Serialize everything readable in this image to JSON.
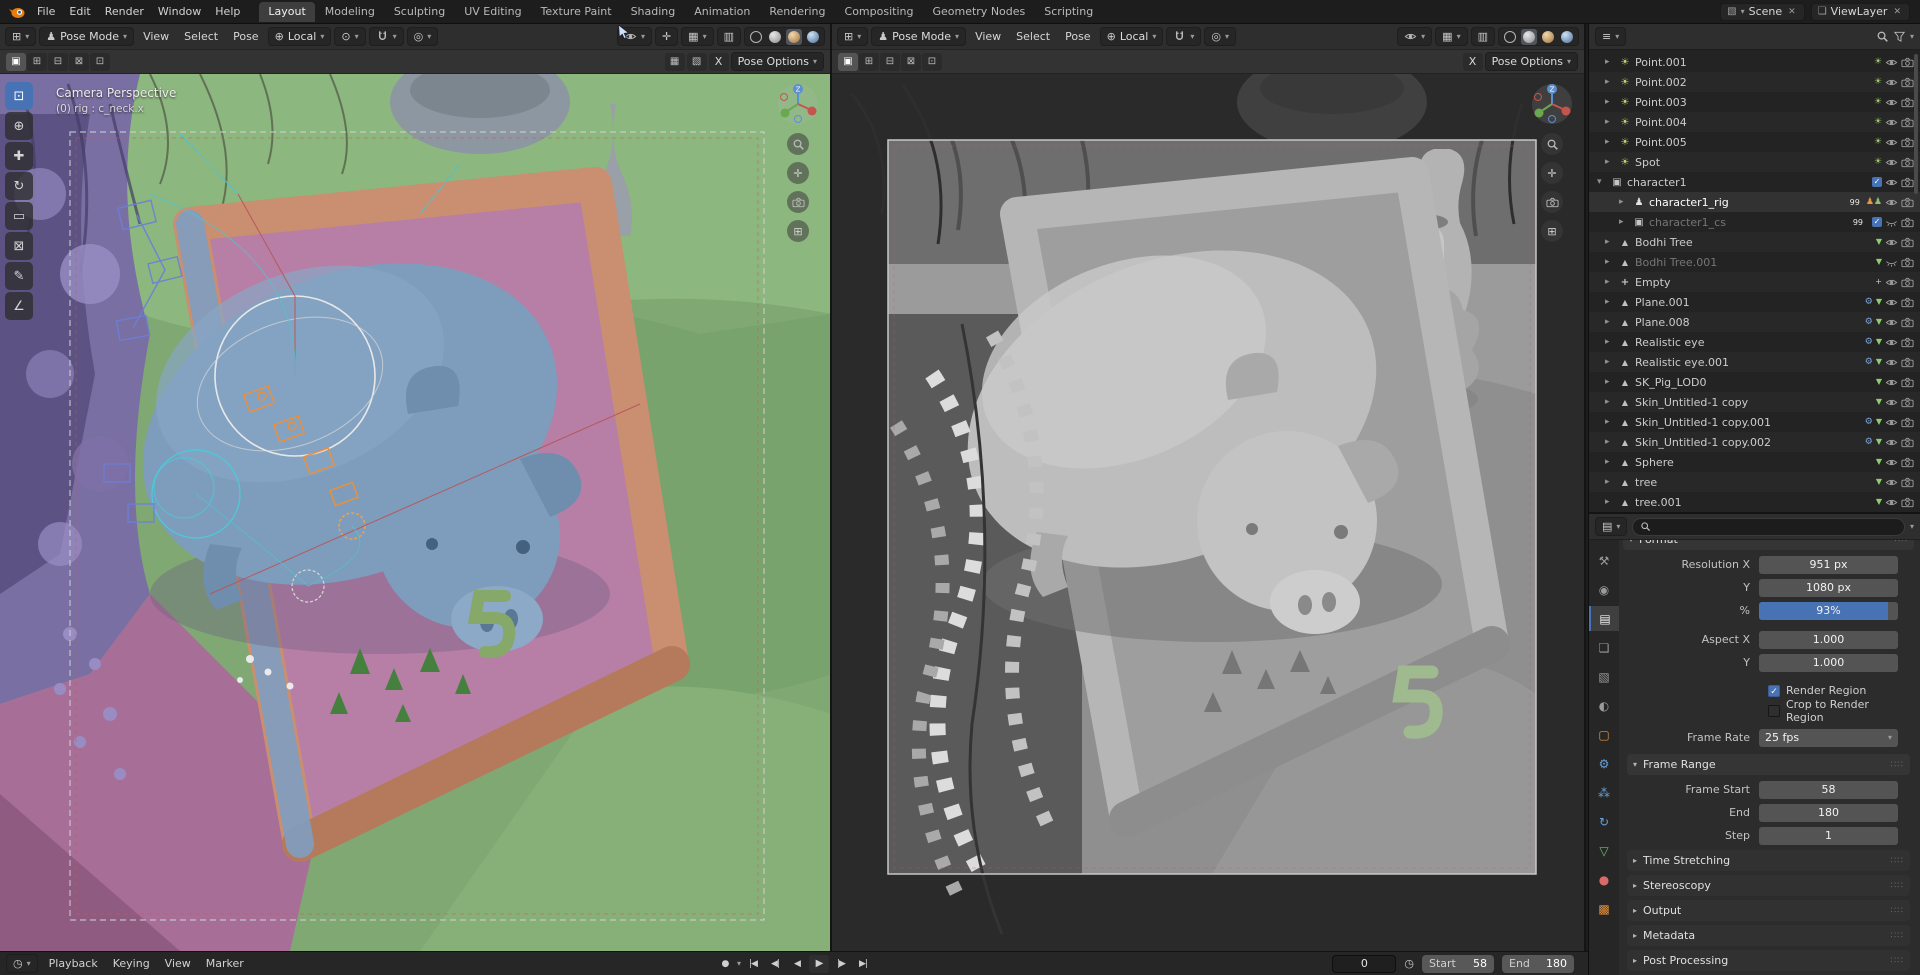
{
  "colors": {
    "accent": "#4772b3",
    "slider_fill": "#4772b3",
    "active_tab_bg": "#3e3e3e",
    "mesh_green": "#8ccf6e",
    "armature_orange": "#e8973c"
  },
  "glyphs": {
    "editor_3d": "⊞",
    "editor_outliner": "≡",
    "editor_props": "▤",
    "editor_timeline": "◷",
    "chevron": "▾",
    "mode": "♟",
    "orientation": "⊕",
    "pivot": "⊙",
    "proportional": "◎",
    "overlays": "▦",
    "xray": "▥",
    "gizmo": "✛",
    "grid": "⊞",
    "collapsed": "▸",
    "expanded": "▾",
    "grip": "∷∷"
  },
  "topbar": {
    "menus": [
      "File",
      "Edit",
      "Render",
      "Window",
      "Help"
    ],
    "workspaces": [
      {
        "label": "Layout",
        "active": "true"
      },
      {
        "label": "Modeling"
      },
      {
        "label": "Sculpting"
      },
      {
        "label": "UV Editing"
      },
      {
        "label": "Texture Paint"
      },
      {
        "label": "Shading"
      },
      {
        "label": "Animation"
      },
      {
        "label": "Rendering"
      },
      {
        "label": "Compositing"
      },
      {
        "label": "Geometry Nodes"
      },
      {
        "label": "Scripting"
      }
    ],
    "scene_name": "Scene",
    "view_layer_name": "ViewLayer"
  },
  "tool_settings": {
    "select_modes": [
      {
        "m": "set",
        "glyph": "▣",
        "active": "true"
      },
      {
        "m": "extend",
        "glyph": "⊞"
      },
      {
        "m": "subtract",
        "glyph": "⊟"
      },
      {
        "m": "invert",
        "glyph": "⊠"
      },
      {
        "m": "intersect",
        "glyph": "⊡"
      }
    ]
  },
  "viewports": {
    "left": {
      "mode": "Pose Mode",
      "menu_view": "View",
      "menu_select": "Select",
      "menu_pose": "Pose",
      "orientation": "Local",
      "mirror_x": "X",
      "tool_popover": "Pose Options",
      "shading_active": "material",
      "overlay_line1": "Camera Perspective",
      "overlay_line2": "(0) rig : c_neck.x",
      "tools": [
        {
          "tool": "select-box",
          "glyph": "⊡",
          "active": "true"
        },
        {
          "tool": "cursor",
          "glyph": "⊕"
        },
        {
          "tool": "move",
          "glyph": "✚"
        },
        {
          "tool": "rotate",
          "glyph": "↻"
        },
        {
          "tool": "scale",
          "glyph": "▭"
        },
        {
          "tool": "transform",
          "glyph": "⊠"
        },
        {
          "tool": "annotate",
          "glyph": "✎"
        },
        {
          "tool": "measure",
          "glyph": "∠"
        }
      ]
    },
    "right": {
      "mode": "Pose Mode",
      "menu_view": "View",
      "menu_select": "Select",
      "menu_pose": "Pose",
      "orientation": "Local",
      "mirror_x": "X",
      "tool_popover": "Pose Options",
      "shading_active": "solid"
    }
  },
  "outliner": {
    "rows": [
      {
        "arrow": "▸",
        "name": "Point.001",
        "type": "light"
      },
      {
        "arrow": "▸",
        "name": "Point.002",
        "type": "light"
      },
      {
        "arrow": "▸",
        "name": "Point.003",
        "type": "light"
      },
      {
        "arrow": "▸",
        "name": "Point.004",
        "type": "light"
      },
      {
        "arrow": "▸",
        "name": "Point.005",
        "type": "light"
      },
      {
        "arrow": "▸",
        "name": "Spot",
        "type": "light"
      },
      {
        "arrow": "▾",
        "name": "character1",
        "type": "collection",
        "depth": "0"
      },
      {
        "arrow": "▸",
        "name": "character1_rig",
        "type": "armature",
        "depth": "2",
        "state": "active",
        "meta": "99"
      },
      {
        "arrow": "▸",
        "name": "character1_cs",
        "type": "collection",
        "depth": "2",
        "state": "muted",
        "meta": "99"
      },
      {
        "arrow": "▸",
        "name": "Bodhi Tree",
        "type": "mesh"
      },
      {
        "arrow": "▸",
        "name": "Bodhi Tree.001",
        "type": "mesh",
        "state": "muted"
      },
      {
        "arrow": "▸",
        "name": "Empty",
        "type": "empty"
      },
      {
        "arrow": "▸",
        "name": "Plane.001",
        "type": "mesh",
        "mod": "⚙"
      },
      {
        "arrow": "▸",
        "name": "Plane.008",
        "type": "mesh",
        "mod": "⚙"
      },
      {
        "arrow": "▸",
        "name": "Realistic eye",
        "type": "mesh",
        "mod": "⚙"
      },
      {
        "arrow": "▸",
        "name": "Realistic eye.001",
        "type": "mesh",
        "mod": "⚙"
      },
      {
        "arrow": "▸",
        "name": "SK_Pig_LOD0",
        "type": "mesh"
      },
      {
        "arrow": "▸",
        "name": "Skin_Untitled-1 copy",
        "type": "mesh"
      },
      {
        "arrow": "▸",
        "name": "Skin_Untitled-1 copy.001",
        "type": "mesh",
        "mod": "⚙"
      },
      {
        "arrow": "▸",
        "name": "Skin_Untitled-1 copy.002",
        "type": "mesh",
        "mod": "⚙"
      },
      {
        "arrow": "▸",
        "name": "Sphere",
        "type": "mesh"
      },
      {
        "arrow": "▸",
        "name": "tree",
        "type": "mesh"
      },
      {
        "arrow": "▸",
        "name": "tree.001",
        "type": "mesh"
      }
    ]
  },
  "properties": {
    "tabs": [
      {
        "tab": "tool",
        "glyph": "⚒",
        "tone": "gray"
      },
      {
        "tab": "render",
        "glyph": "◉",
        "tone": "gray"
      },
      {
        "tab": "output",
        "glyph": "▤",
        "tone": "gray",
        "active": "true"
      },
      {
        "tab": "view-layer",
        "glyph": "❏",
        "tone": "gray"
      },
      {
        "tab": "scene",
        "glyph": "▧",
        "tone": "gray"
      },
      {
        "tab": "world",
        "glyph": "◐",
        "tone": "gray"
      },
      {
        "tab": "object",
        "glyph": "▢",
        "tone": "orange"
      },
      {
        "tab": "modifiers",
        "glyph": "⚙",
        "tone": "blue"
      },
      {
        "tab": "particles",
        "glyph": "⁂",
        "tone": "blue"
      },
      {
        "tab": "physics",
        "glyph": "↻",
        "tone": "blue"
      },
      {
        "tab": "data",
        "glyph": "▽",
        "tone": "green"
      },
      {
        "tab": "material",
        "glyph": "●",
        "tone": "red"
      },
      {
        "tab": "texture",
        "glyph": "▩",
        "tone": "orange"
      }
    ],
    "search_placeholder": "",
    "format_section": "Format",
    "resolution_x_label": "Resolution X",
    "resolution_x_value": "951 px",
    "resolution_y_label": "Y",
    "resolution_y_value": "1080 px",
    "resolution_pct_label": "%",
    "resolution_pct_value": "93%",
    "resolution_pct_style": "width:93%",
    "aspect_x_label": "Aspect X",
    "aspect_x_value": "1.000",
    "aspect_y_label": "Y",
    "aspect_y_value": "1.000",
    "render_region_label": "Render Region",
    "render_region_checked": true,
    "crop_region_label": "Crop to Render Region",
    "crop_region_checked": false,
    "frame_rate_label": "Frame Rate",
    "frame_rate_value": "25 fps",
    "frame_range_title": "Frame Range",
    "frame_start_label": "Frame Start",
    "frame_start_value": "58",
    "frame_end_label": "End",
    "frame_end_value": "180",
    "frame_step_label": "Step",
    "frame_step_value": "1",
    "collapsed_sections": [
      "Time Stretching",
      "Stereoscopy",
      "Output",
      "Metadata",
      "Post Processing"
    ]
  },
  "timeline": {
    "menus": [
      "Playback",
      "Keying",
      "View",
      "Marker"
    ],
    "icons": {
      "autokey": "●",
      "jump_first": "|◀",
      "prev_key": "◀|",
      "play_rev": "◀",
      "play": "▶",
      "next_key": "|▶",
      "jump_last": "▶|",
      "clock": "◷"
    },
    "current_frame": "0",
    "start_label": "Start",
    "start_value": "58",
    "end_label": "End",
    "end_value": "180"
  }
}
